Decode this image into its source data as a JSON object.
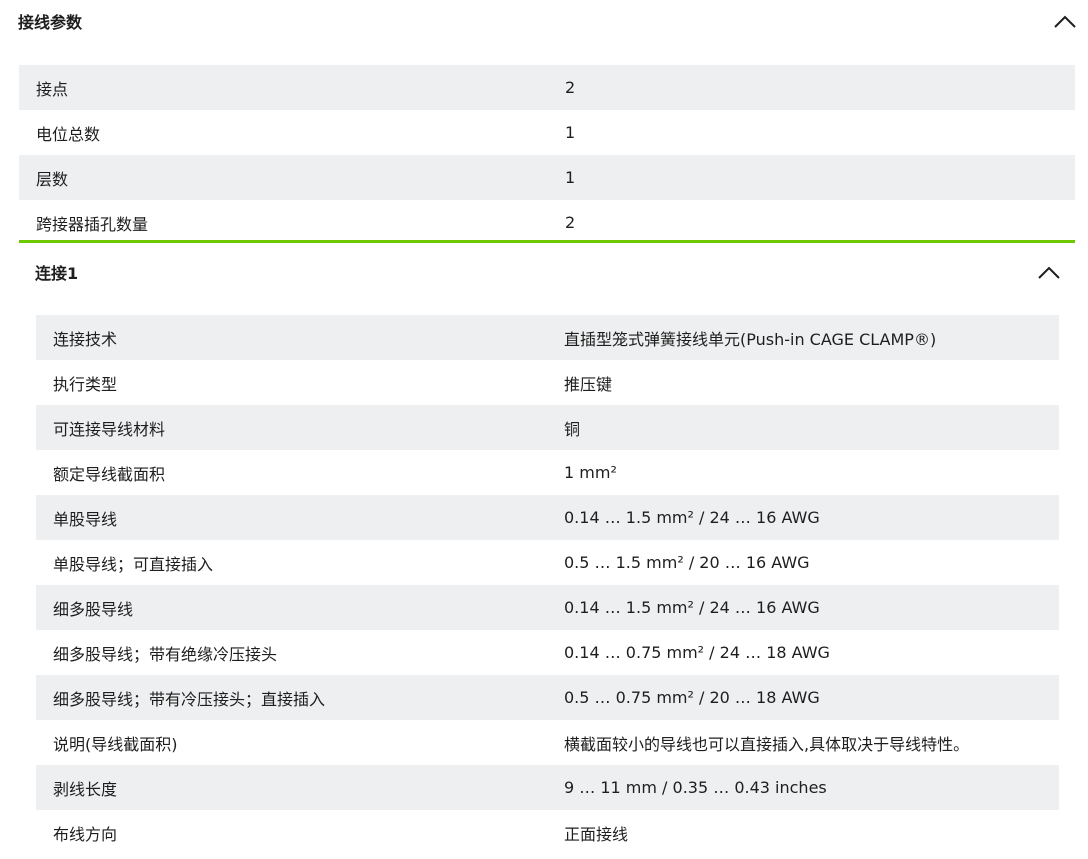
{
  "section1": {
    "title": "接线参数",
    "rows": [
      {
        "label": "接点",
        "value": "2"
      },
      {
        "label": "电位总数",
        "value": "1"
      },
      {
        "label": "层数",
        "value": "1"
      },
      {
        "label": "跨接器插孔数量",
        "value": "2"
      }
    ]
  },
  "section2": {
    "title": "连接1",
    "rows": [
      {
        "label": "连接技术",
        "value": "直插型笼式弹簧接线单元(Push-in CAGE CLAMP®)"
      },
      {
        "label": "执行类型",
        "value": "推压键"
      },
      {
        "label": "可连接导线材料",
        "value": "铜"
      },
      {
        "label": "额定导线截面积",
        "value": "1 mm²"
      },
      {
        "label": "单股导线",
        "value": "0.14 … 1.5 mm² / 24 … 16 AWG"
      },
      {
        "label": "单股导线；可直接插入",
        "value": "0.5 … 1.5 mm² / 20 … 16 AWG"
      },
      {
        "label": "细多股导线",
        "value": "0.14 … 1.5 mm² / 24 … 16 AWG"
      },
      {
        "label": "细多股导线；带有绝缘冷压接头",
        "value": "0.14 … 0.75 mm² / 24 … 18 AWG"
      },
      {
        "label": "细多股导线；带有冷压接头；直接插入",
        "value": "0.5 … 0.75 mm² / 20 … 18 AWG"
      },
      {
        "label": "说明(导线截面积)",
        "value": "横截面较小的导线也可以直接插入,具体取决于导线特性。"
      },
      {
        "label": "剥线长度",
        "value": "9 … 11 mm / 0.35 … 0.43 inches"
      },
      {
        "label": "布线方向",
        "value": "正面接线"
      }
    ]
  },
  "icons": {
    "collapse": "chevron-up-icon"
  },
  "colors": {
    "accent": "#6ec800",
    "row_alt": "#eeeff0"
  }
}
